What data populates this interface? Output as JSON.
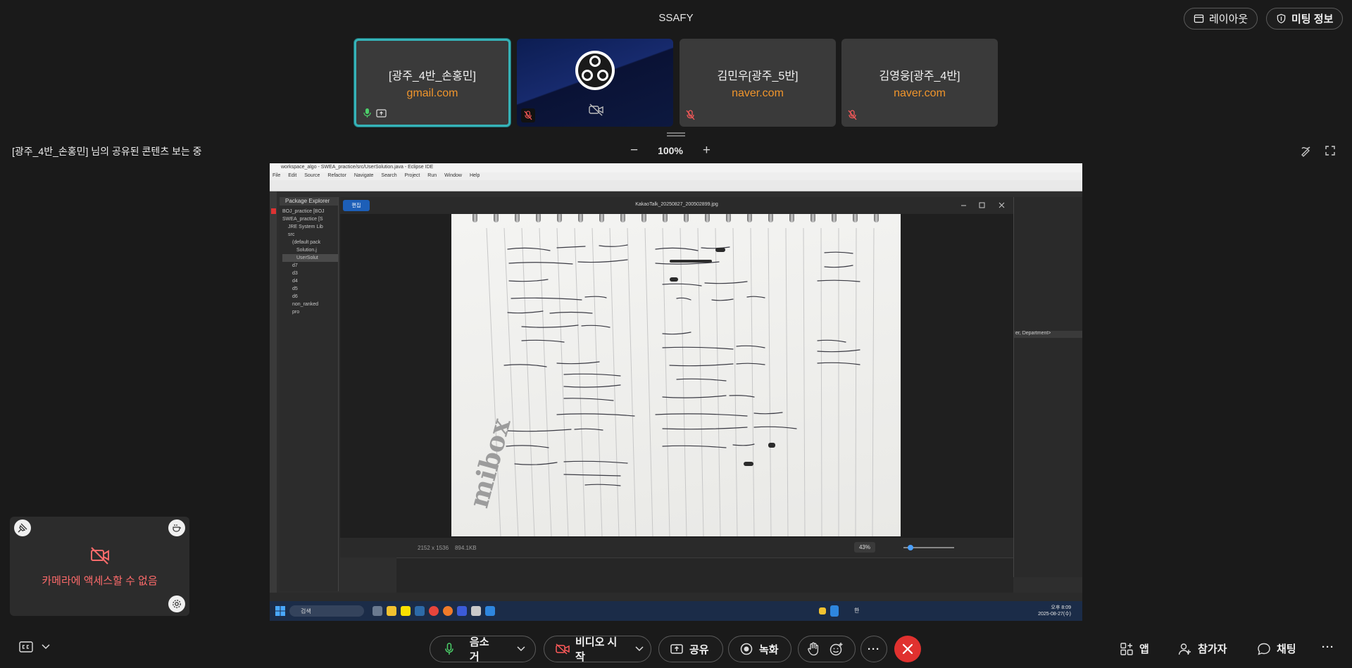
{
  "meeting": {
    "title": "SSAFY"
  },
  "top_buttons": {
    "layout": "레이아웃",
    "meeting_info": "미팅 정보"
  },
  "participants": [
    {
      "name": "[광주_4반_손홍민]",
      "email": "gmail.com"
    },
    {
      "name": "",
      "email": ""
    },
    {
      "name": "김민우[광주_5반]",
      "email": "naver.com"
    },
    {
      "name": "김영웅[광주_4반]",
      "email": "naver.com"
    }
  ],
  "share": {
    "label": "[광주_4반_손홍민] 님의 공유된 콘텐츠 보는 중",
    "zoom": "100%",
    "zoom_out": "−",
    "zoom_in": "+"
  },
  "shared_screen": {
    "eclipse_title": "workspace_algo - SWEA_practice/src/UserSolution.java - Eclipse IDE",
    "menu": [
      "File",
      "Edit",
      "Source",
      "Refactor",
      "Navigate",
      "Search",
      "Project",
      "Run",
      "Window",
      "Help"
    ],
    "package_explorer": "Package Explorer",
    "tree": [
      "BOJ_practice [BOJ",
      "SWEA_practice [S",
      "JRE System Lib",
      "src",
      "(default pack",
      "Solution.j",
      "UserSolut",
      "d7",
      "d3",
      "d4",
      "d5",
      "d6",
      "non_ranked",
      "pro"
    ],
    "right_panel_text": "er, Department>",
    "viewer_edit": "편집",
    "viewer_filename": "KakaoTalk_20250827_200502899.jpg",
    "image_size": "2152 x 1536",
    "file_size": "894.1KB",
    "viewer_zoom": "43%",
    "taskbar_search": "검색",
    "clock_time": "오후 8:09",
    "clock_date": "2025-08-27(수)",
    "ime": "한"
  },
  "self_view": {
    "message": "카메라에 액세스할 수 없음"
  },
  "controls": {
    "mute": "음소거",
    "video": "비디오 시작",
    "share": "공유",
    "record": "녹화",
    "more": "···",
    "apps": "앱",
    "participants": "참가자",
    "chat": "채팅",
    "more_right": "···"
  },
  "colors": {
    "accent": "#36b3b8",
    "email": "#f0952c",
    "danger": "#e0312f",
    "muted_mic": "#ff5a5a"
  }
}
